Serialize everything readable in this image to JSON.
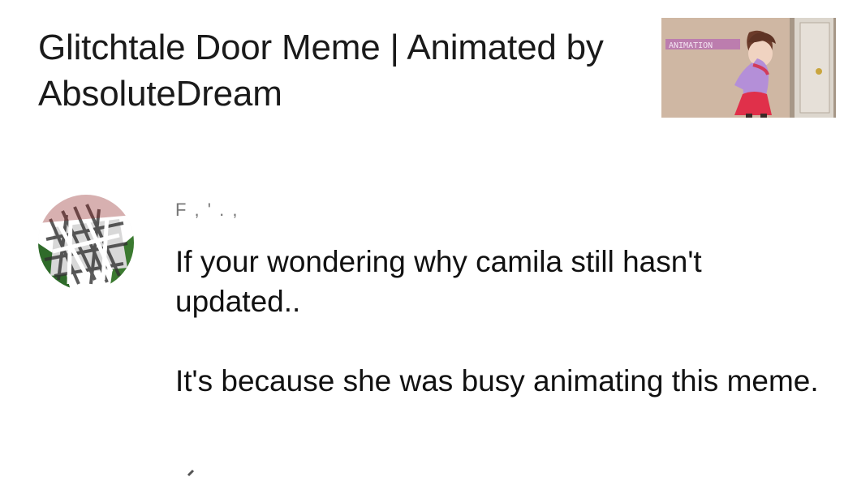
{
  "video": {
    "title": "Glitchtale Door Meme | Animated by AbsoluteDream",
    "thumbnail": {
      "label_text": "ANIMATION",
      "colors": {
        "wall": "#cbb39e",
        "door": "#d9d2c8",
        "door_frame": "#9c8f82",
        "hair": "#6b3b2a",
        "shirt": "#b48fd8",
        "skirt": "#e0304a",
        "banner": "#b873b0"
      }
    }
  },
  "comment": {
    "author_line": "F ,   ' .   ,",
    "text": "If your wondering why camila still hasn't updated..\n\n  It's because she was busy animating this meme.",
    "avatar_icon": "scribbled-avatar-icon"
  }
}
